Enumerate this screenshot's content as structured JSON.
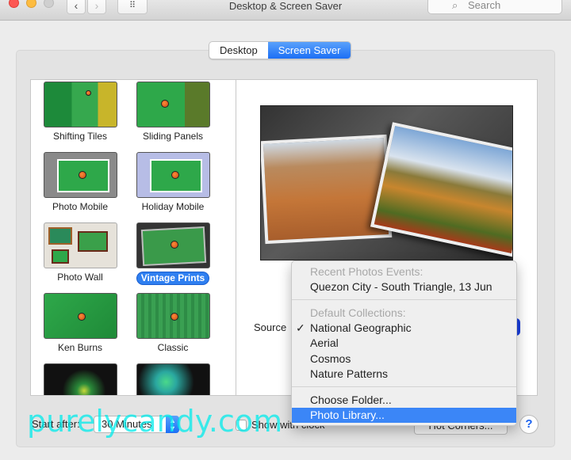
{
  "window": {
    "title": "Desktop & Screen Saver",
    "search_placeholder": "Search",
    "back_glyph": "‹",
    "forward_glyph": "›",
    "grid_glyph": "⠿"
  },
  "tabs": [
    {
      "label": "Desktop",
      "active": false
    },
    {
      "label": "Screen Saver",
      "active": true
    }
  ],
  "screen_savers": [
    {
      "label": "Shifting Tiles",
      "selected": false
    },
    {
      "label": "Sliding Panels",
      "selected": false
    },
    {
      "label": "Photo Mobile",
      "selected": false
    },
    {
      "label": "Holiday Mobile",
      "selected": false
    },
    {
      "label": "Photo Wall",
      "selected": false
    },
    {
      "label": "Vintage Prints",
      "selected": true
    },
    {
      "label": "Ken Burns",
      "selected": false
    },
    {
      "label": "Classic",
      "selected": false
    },
    {
      "label": "",
      "selected": false
    },
    {
      "label": "",
      "selected": false
    }
  ],
  "source": {
    "label": "Source",
    "menu": {
      "recent_header": "Recent Photos Events:",
      "recent_items": [
        "Quezon City - South Triangle, 13 Jun"
      ],
      "default_header": "Default Collections:",
      "default_items": [
        "National Geographic",
        "Aerial",
        "Cosmos",
        "Nature Patterns"
      ],
      "checked_item": "National Geographic",
      "check_glyph": "✓",
      "choose_folder": "Choose Folder...",
      "photo_library": "Photo Library...",
      "highlighted_item": "Photo Library..."
    }
  },
  "bottom": {
    "start_after_label": "Start after:",
    "start_after_value": "30 Minutes",
    "show_clock_label": "Show with clock",
    "show_clock_checked": false,
    "hot_corners_label": "Hot Corners...",
    "help_glyph": "?"
  },
  "watermark": "purelycandy.com",
  "colors": {
    "accent": "#2f7ff0",
    "menu_highlight": "#3b86f7"
  }
}
